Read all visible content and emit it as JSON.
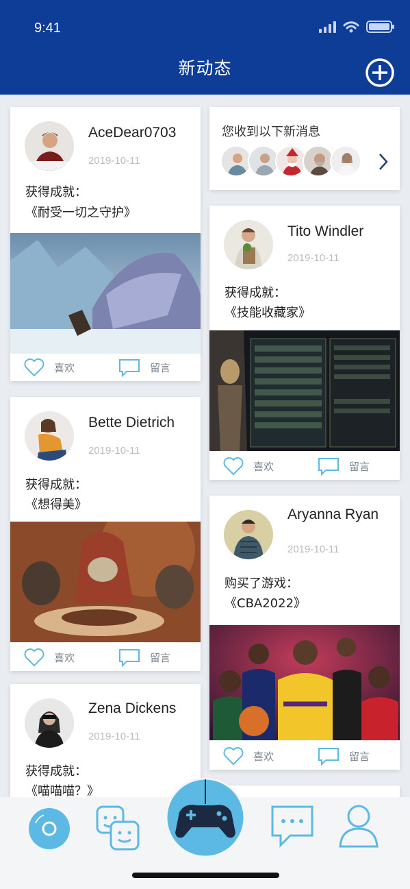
{
  "status_bar": {
    "time": "9:41"
  },
  "header": {
    "title": "新动态",
    "add_icon": "plus-circle-icon"
  },
  "colors": {
    "header_bg": "#0d3d97",
    "accent": "#5bb9e3",
    "page_bg": "#e9ecf1"
  },
  "messages": {
    "title": "您收到以下新消息",
    "avatar_count": 5
  },
  "posts": [
    {
      "user": "AceDear0703",
      "date": "2019-10-11",
      "type": "获得成就：",
      "content": "《耐受一切之守护》",
      "like": "喜欢",
      "comment": "留言"
    },
    {
      "user": "Tito Windler",
      "date": "2019-10-11",
      "type": "获得成就：",
      "content": "《技能收藏家》",
      "like": "喜欢",
      "comment": "留言"
    },
    {
      "user": "Bette Dietrich",
      "date": "2019-10-11",
      "type": "获得成就：",
      "content": "《想得美》",
      "like": "喜欢",
      "comment": "留言"
    },
    {
      "user": "Aryanna Ryan",
      "date": "2019-10-11",
      "type": "购买了游戏：",
      "content": "《CBA2022》",
      "like": "喜欢",
      "comment": "留言"
    },
    {
      "user": "Zena Dickens",
      "date": "2019-10-11",
      "type": "获得成就：",
      "content": "《喵喵喵？》"
    }
  ],
  "tabs": [
    {
      "icon": "disc-icon"
    },
    {
      "icon": "faces-icon"
    },
    {
      "icon": "gamepad-icon"
    },
    {
      "icon": "chat-icon"
    },
    {
      "icon": "profile-icon"
    }
  ]
}
